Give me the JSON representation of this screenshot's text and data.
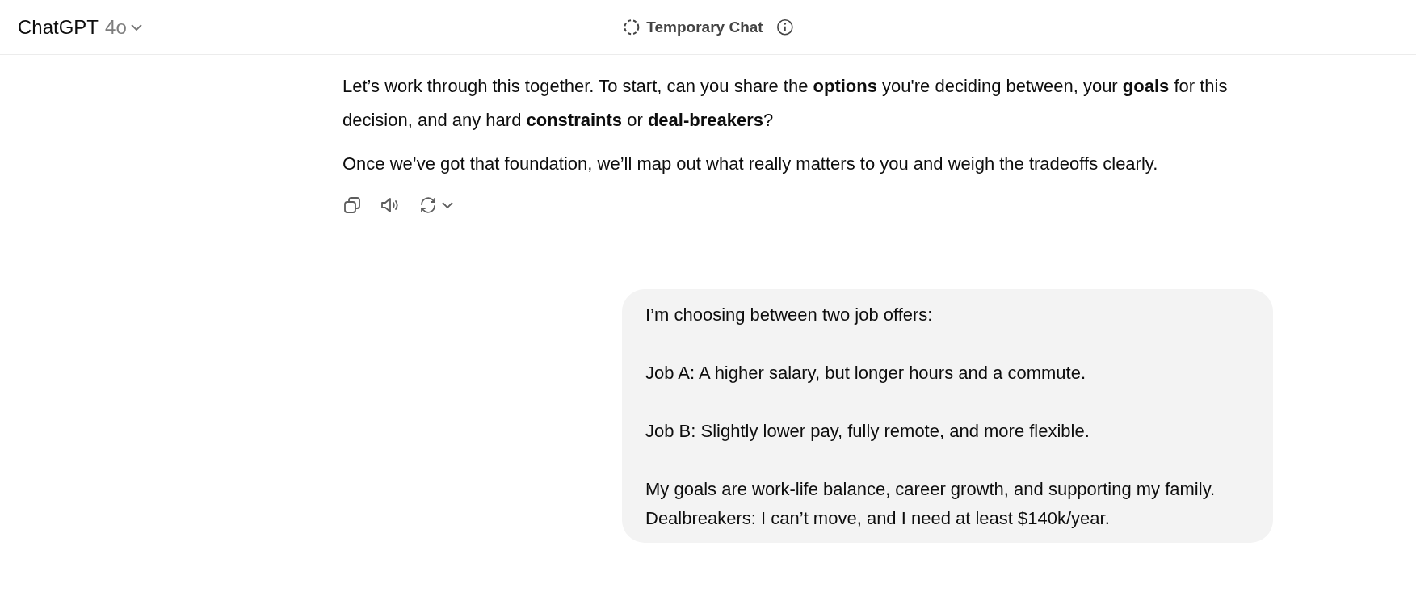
{
  "header": {
    "title": "ChatGPT",
    "model": "4o",
    "center_label": "Temporary Chat"
  },
  "assistant_message": {
    "paragraphs": [
      "Let’s work through this together. To start, can you share the **options** you're deciding between, your **goals** for this decision, and any hard **constraints** or **deal-breakers**?",
      "Once we’ve got that foundation, we’ll map out what really matters to you and weigh the tradeoffs clearly."
    ],
    "actions": [
      {
        "kind": "copy"
      },
      {
        "kind": "read-aloud"
      },
      {
        "kind": "regenerate"
      }
    ]
  },
  "user_message": {
    "text": "I’m choosing between two job offers:\n\nJob A: A higher salary, but longer hours and a commute.\n\nJob B: Slightly lower pay, fully remote, and more flexible.\n\nMy goals are work-life balance, career growth, and supporting my family.\nDealbreakers: I can’t move, and I need at least $140k/year."
  }
}
